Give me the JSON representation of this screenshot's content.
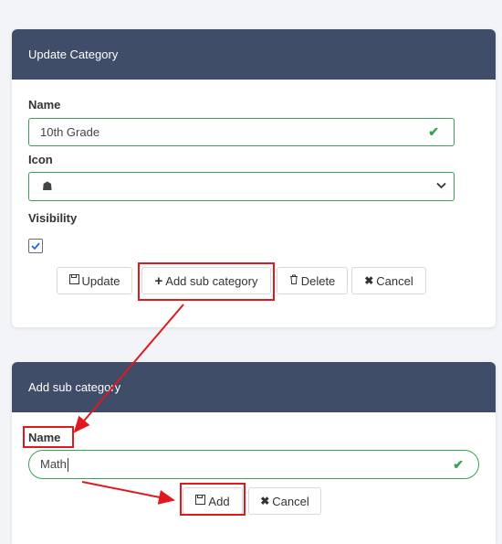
{
  "update_card": {
    "title": "Update Category",
    "name_label": "Name",
    "name_value": "10th Grade",
    "icon_label": "Icon",
    "icon_glyph": "☗",
    "visibility_label": "Visibility",
    "visibility_checked": true,
    "buttons": {
      "update": "Update",
      "add_sub": "Add sub category",
      "delete": "Delete",
      "cancel": "Cancel"
    }
  },
  "add_card": {
    "title": "Add sub category",
    "name_label": "Name",
    "name_value": "Math",
    "buttons": {
      "add": "Add",
      "cancel": "Cancel"
    }
  },
  "icons": {
    "save": "💾",
    "plus": "+",
    "trash": "🗑",
    "times": "✖",
    "check": "✔",
    "chevron": "⌄"
  },
  "colors": {
    "header_bg": "#3f4d69",
    "valid_green": "#36a352",
    "annotation_red": "#e0191e"
  }
}
